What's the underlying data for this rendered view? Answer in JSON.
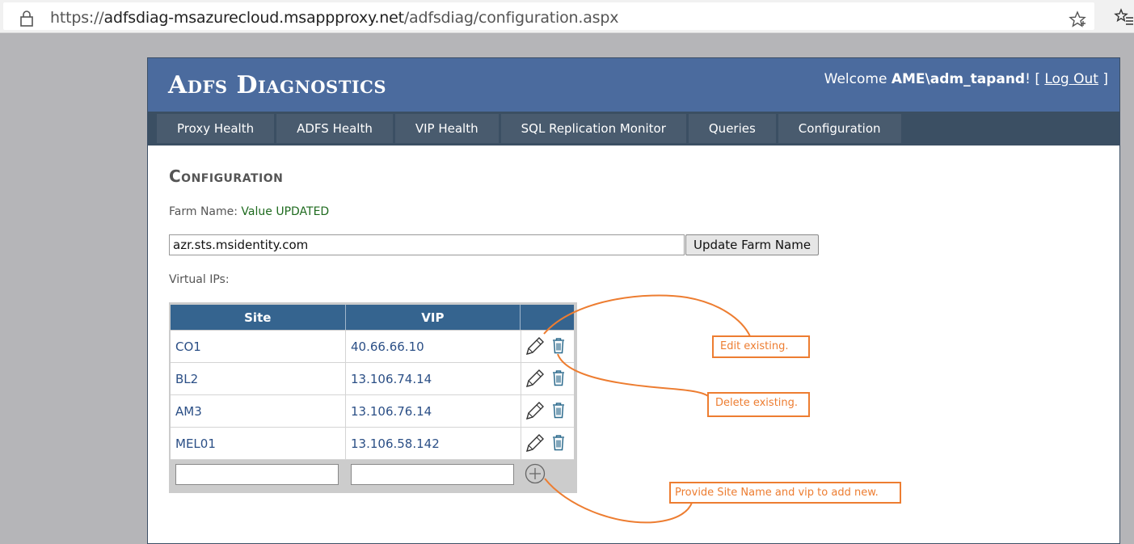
{
  "browser": {
    "url_prefix": "https://",
    "url_host": "adfsdiag-msazurecloud.msappproxy.net",
    "url_path": "/adfsdiag/configuration.aspx"
  },
  "header": {
    "title": "Adfs Diagnostics",
    "welcome_prefix": "Welcome ",
    "user": "AME\\adm_tapand",
    "welcome_suffix": "! [ ",
    "logout": "Log Out",
    "close_bracket": " ]"
  },
  "nav": {
    "tabs": [
      "Proxy Health",
      "ADFS Health",
      "VIP Health",
      "SQL Replication Monitor",
      "Queries",
      "Configuration"
    ]
  },
  "main": {
    "heading": "Configuration",
    "farm_label": "Farm Name: ",
    "farm_status": "Value UPDATED",
    "farm_value": "azr.sts.msidentity.com",
    "update_button": "Update Farm Name",
    "vip_label": "Virtual IPs:"
  },
  "table": {
    "headers": [
      "Site",
      "VIP"
    ],
    "rows": [
      {
        "site": "CO1",
        "vip": "40.66.66.10"
      },
      {
        "site": "BL2",
        "vip": "13.106.74.14"
      },
      {
        "site": "AM3",
        "vip": "13.106.76.14"
      },
      {
        "site": "MEL01",
        "vip": "13.106.58.142"
      }
    ],
    "new_site_value": "",
    "new_vip_value": ""
  },
  "annotations": {
    "edit": "Edit existing.",
    "delete": "Delete existing.",
    "add": "Provide Site Name and vip to add new.",
    "color": "#ed7d31"
  },
  "icons": [
    "lock-icon",
    "star-icon",
    "favorites-icon",
    "edit-icon",
    "trash-icon",
    "add-icon"
  ]
}
